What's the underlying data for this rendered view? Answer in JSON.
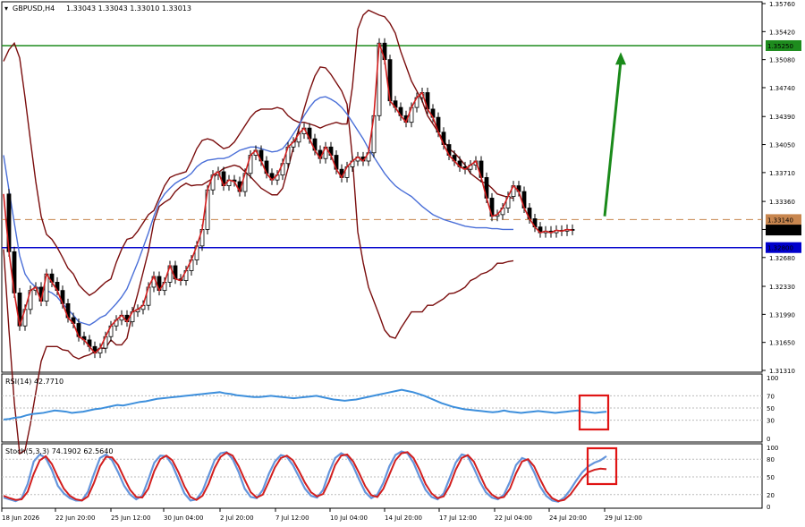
{
  "header": {
    "symbol": "GBPUSD,H4",
    "ohlc": "1.33043 1.33043 1.33010 1.33013"
  },
  "chart_data": {
    "type": "line",
    "x_ticks": [
      "18 Jun 2026",
      "22 Jun 20:00",
      "25 Jun 12:00",
      "30 Jun 04:00",
      "2 Jul 20:00",
      "7 Jul 12:00",
      "10 Jul 04:00",
      "14 Jul 20:00",
      "17 Jul 12:00",
      "22 Jul 04:00",
      "24 Jul 20:00",
      "29 Jul 12:00"
    ],
    "y_ticks": [
      "1.35760",
      "1.35420",
      "1.35080",
      "1.34740",
      "1.34390",
      "1.34050",
      "1.33710",
      "1.33360",
      "1.33020",
      "1.32680",
      "1.32330",
      "1.31990",
      "1.31650",
      "1.31310"
    ],
    "ylim": [
      1.3131,
      1.3576
    ],
    "levels": [
      {
        "label": "1.35250",
        "value": 1.3525,
        "color": "#1e8c1e",
        "style": "solid"
      },
      {
        "label": "1.33140",
        "value": 1.3314,
        "color": "#c8864f",
        "style": "dashed"
      },
      {
        "label": "1.33013",
        "value": 1.33013,
        "color": "#000000",
        "style": "current"
      },
      {
        "label": "1.32800",
        "value": 1.328,
        "color": "#0000cc",
        "style": "solid"
      }
    ],
    "price": {
      "x": [
        0,
        6,
        12,
        18,
        24,
        30,
        36,
        42,
        48,
        54,
        60,
        66,
        72,
        78,
        84,
        90,
        96,
        102,
        108,
        114,
        120,
        126,
        132,
        138,
        144,
        150,
        156,
        162,
        168,
        174,
        180,
        186,
        192,
        198,
        204,
        210,
        216,
        222,
        228,
        234,
        240,
        246,
        252,
        258,
        264,
        270,
        276,
        282,
        288,
        294,
        300,
        306,
        312,
        318,
        324,
        330,
        336,
        342,
        348,
        354,
        360,
        366,
        372,
        378,
        384,
        390,
        396,
        402,
        408,
        414,
        420,
        426,
        432,
        438,
        444,
        450,
        456,
        462,
        468,
        474,
        480,
        486,
        492,
        498,
        504,
        510,
        516,
        522,
        528,
        534,
        540,
        546,
        552,
        558,
        564,
        570,
        576,
        582,
        588,
        594,
        600,
        606,
        612,
        618,
        624,
        630,
        636,
        642,
        648,
        654,
        660,
        666,
        672
      ],
      "close": [
        1.3345,
        1.3275,
        1.3225,
        1.3185,
        1.3205,
        1.3228,
        1.3232,
        1.3215,
        1.3248,
        1.3238,
        1.3228,
        1.3212,
        1.3195,
        1.3188,
        1.3172,
        1.3168,
        1.316,
        1.3152,
        1.3158,
        1.3172,
        1.3185,
        1.3192,
        1.3198,
        1.319,
        1.3202,
        1.3205,
        1.321,
        1.3232,
        1.3245,
        1.3228,
        1.3238,
        1.3258,
        1.3242,
        1.324,
        1.3252,
        1.3265,
        1.3282,
        1.3302,
        1.335,
        1.3368,
        1.3372,
        1.3355,
        1.3362,
        1.336,
        1.3348,
        1.337,
        1.3392,
        1.3398,
        1.3385,
        1.337,
        1.3362,
        1.3368,
        1.3382,
        1.3402,
        1.3408,
        1.3418,
        1.3425,
        1.3412,
        1.3398,
        1.3388,
        1.3402,
        1.3392,
        1.3375,
        1.3365,
        1.3378,
        1.3385,
        1.339,
        1.3385,
        1.3395,
        1.344,
        1.3528,
        1.3508,
        1.3458,
        1.345,
        1.344,
        1.3432,
        1.345,
        1.3462,
        1.3468,
        1.3448,
        1.3438,
        1.342,
        1.3405,
        1.3392,
        1.3385,
        1.3378,
        1.3375,
        1.338,
        1.3385,
        1.3365,
        1.334,
        1.3318,
        1.332,
        1.3328,
        1.3342,
        1.3355,
        1.3348,
        1.3328,
        1.3315,
        1.3305,
        1.3298,
        1.33,
        1.3298,
        1.3301,
        1.33,
        1.3302,
        1.3301
      ],
      "upper_band": [
        1.3506,
        1.352,
        1.3528,
        1.351,
        1.3462,
        1.341,
        1.336,
        1.3318,
        1.3296,
        1.329,
        1.328,
        1.3268,
        1.3255,
        1.3248,
        1.3235,
        1.3228,
        1.3222,
        1.3226,
        1.3232,
        1.3238,
        1.3242,
        1.3262,
        1.3278,
        1.329,
        1.3292,
        1.33,
        1.331,
        1.332,
        1.3325,
        1.334,
        1.3355,
        1.3365,
        1.3368,
        1.337,
        1.3372,
        1.3385,
        1.34,
        1.341,
        1.3412,
        1.341,
        1.3405,
        1.34,
        1.3402,
        1.3408,
        1.3418,
        1.3428,
        1.3438,
        1.3445,
        1.3448,
        1.3448,
        1.3448,
        1.345,
        1.3448,
        1.344,
        1.3435,
        1.3432,
        1.3432,
        1.343,
        1.3428,
        1.3425,
        1.3428,
        1.343,
        1.3432,
        1.343,
        1.343,
        1.3475,
        1.3545,
        1.3562,
        1.3568,
        1.3565,
        1.3562,
        1.356,
        1.3552,
        1.354,
        1.3518,
        1.35,
        1.3482,
        1.347,
        1.3458,
        1.344,
        1.343,
        1.342,
        1.341,
        1.34,
        1.3395,
        1.3388,
        1.338,
        1.337,
        1.3365,
        1.336,
        1.3358,
        1.3352,
        1.3345,
        1.3343,
        1.3341,
        1.334
      ],
      "middle": [
        1.3392,
        1.335,
        1.331,
        1.327,
        1.3248,
        1.3238,
        1.3232,
        1.323,
        1.3228,
        1.3225,
        1.322,
        1.3212,
        1.3205,
        1.3198,
        1.319,
        1.3188,
        1.3186,
        1.319,
        1.3195,
        1.3198,
        1.3205,
        1.3212,
        1.322,
        1.323,
        1.3246,
        1.3262,
        1.328,
        1.3298,
        1.3318,
        1.3335,
        1.3345,
        1.3352,
        1.3358,
        1.3362,
        1.3365,
        1.337,
        1.3378,
        1.3383,
        1.3386,
        1.3387,
        1.3388,
        1.3388,
        1.339,
        1.3394,
        1.3398,
        1.34,
        1.3402,
        1.3402,
        1.34,
        1.3398,
        1.3396,
        1.3397,
        1.34,
        1.3408,
        1.3418,
        1.3428,
        1.344,
        1.345,
        1.3458,
        1.3462,
        1.3463,
        1.346,
        1.3456,
        1.345,
        1.3442,
        1.3432,
        1.3422,
        1.3412,
        1.34,
        1.339,
        1.338,
        1.337,
        1.3362,
        1.3355,
        1.335,
        1.3346,
        1.3342,
        1.3336,
        1.333,
        1.3325,
        1.332,
        1.3317,
        1.3314,
        1.3312,
        1.331,
        1.3308,
        1.3306,
        1.3305,
        1.3304,
        1.3304,
        1.3304,
        1.3303,
        1.3303,
        1.3302,
        1.3302,
        1.3302
      ],
      "lower_band": [
        1.3278,
        1.318,
        1.3092,
        1.303,
        1.3034,
        1.3066,
        1.3104,
        1.3142,
        1.316,
        1.316,
        1.316,
        1.3156,
        1.3155,
        1.3148,
        1.3145,
        1.3148,
        1.315,
        1.3154,
        1.3158,
        1.3158,
        1.3168,
        1.3162,
        1.3162,
        1.317,
        1.32,
        1.3224,
        1.325,
        1.3276,
        1.3311,
        1.333,
        1.3335,
        1.3339,
        1.3348,
        1.3354,
        1.3358,
        1.3355,
        1.3356,
        1.3356,
        1.336,
        1.3364,
        1.3371,
        1.3376,
        1.3378,
        1.338,
        1.3378,
        1.3372,
        1.3366,
        1.3359,
        1.3352,
        1.3348,
        1.3344,
        1.3344,
        1.3352,
        1.3376,
        1.3401,
        1.3424,
        1.3448,
        1.347,
        1.3488,
        1.3499,
        1.3498,
        1.349,
        1.348,
        1.347,
        1.3454,
        1.3389,
        1.3299,
        1.3262,
        1.3232,
        1.3215,
        1.3198,
        1.318,
        1.3172,
        1.317,
        1.3182,
        1.3192,
        1.3202,
        1.3202,
        1.3202,
        1.321,
        1.321,
        1.3214,
        1.3218,
        1.3224,
        1.3225,
        1.3228,
        1.3232,
        1.324,
        1.3243,
        1.3248,
        1.325,
        1.3254,
        1.3261,
        1.3261,
        1.3263,
        1.3264
      ]
    },
    "rsi": {
      "label": "RSI(14) 42.7710",
      "ticks": [
        "100",
        "70",
        "50",
        "30",
        "0"
      ],
      "levels": [
        70,
        50,
        30
      ],
      "values": [
        31,
        32,
        34,
        35,
        38,
        40,
        41,
        42,
        44,
        46,
        45,
        44,
        42,
        43,
        44,
        46,
        48,
        49,
        51,
        53,
        55,
        54,
        56,
        58,
        60,
        61,
        63,
        65,
        66,
        67,
        68,
        69,
        70,
        71,
        72,
        73,
        74,
        75,
        76,
        74,
        73,
        71,
        70,
        69,
        68,
        68,
        69,
        70,
        69,
        68,
        67,
        66,
        67,
        68,
        69,
        70,
        68,
        66,
        64,
        63,
        62,
        63,
        64,
        66,
        68,
        70,
        72,
        74,
        76,
        78,
        80,
        78,
        76,
        73,
        70,
        66,
        62,
        58,
        55,
        52,
        50,
        48,
        47,
        46,
        45,
        44,
        43,
        44,
        46,
        44,
        43,
        42,
        43,
        44,
        45,
        44,
        43,
        42,
        43,
        44,
        45,
        46,
        44,
        43,
        42,
        43,
        44
      ],
      "color": "#3d8fdc"
    },
    "stoch": {
      "label": "Stoch(5,3,3) 74.1902 62.5640",
      "ticks": [
        "100",
        "80",
        "50",
        "20",
        "0"
      ],
      "levels": [
        80,
        50,
        20
      ],
      "k_values": [
        15,
        12,
        9,
        14,
        38,
        76,
        88,
        82,
        62,
        35,
        22,
        14,
        10,
        10,
        25,
        55,
        82,
        88,
        78,
        58,
        35,
        20,
        12,
        18,
        45,
        74,
        86,
        85,
        70,
        46,
        22,
        10,
        12,
        26,
        52,
        78,
        90,
        92,
        80,
        58,
        30,
        16,
        14,
        28,
        55,
        76,
        87,
        84,
        70,
        50,
        30,
        18,
        15,
        28,
        58,
        82,
        90,
        85,
        68,
        45,
        24,
        14,
        20,
        40,
        68,
        87,
        93,
        90,
        74,
        50,
        28,
        16,
        12,
        22,
        48,
        74,
        88,
        85,
        65,
        42,
        24,
        15,
        12,
        20,
        42,
        70,
        82,
        78,
        58,
        34,
        18,
        10,
        8,
        15,
        28,
        44,
        58,
        68,
        74,
        78,
        85
      ],
      "d_values": [
        18,
        14,
        11,
        12,
        25,
        55,
        78,
        85,
        72,
        50,
        30,
        18,
        12,
        10,
        17,
        40,
        68,
        84,
        83,
        70,
        48,
        28,
        16,
        15,
        30,
        60,
        80,
        86,
        78,
        58,
        34,
        16,
        11,
        18,
        38,
        65,
        84,
        91,
        86,
        68,
        45,
        24,
        15,
        20,
        42,
        66,
        82,
        86,
        78,
        60,
        40,
        24,
        17,
        21,
        42,
        70,
        86,
        88,
        76,
        56,
        34,
        19,
        16,
        30,
        54,
        78,
        90,
        92,
        82,
        62,
        38,
        22,
        14,
        17,
        35,
        62,
        82,
        87,
        76,
        54,
        32,
        20,
        14,
        16,
        30,
        56,
        76,
        80,
        68,
        46,
        26,
        14,
        9,
        11,
        20,
        34,
        48,
        58,
        62,
        64,
        63
      ],
      "k_color": "#6495dc",
      "d_color": "#d21e1e"
    },
    "colors": {
      "candles": "#000000",
      "bands": "#7a0d0d",
      "middle_band": "#4a6fd8",
      "fast_ma": "#d21e1e",
      "arrow": "#1a8a1a",
      "highlight_box": "#e01414"
    }
  }
}
